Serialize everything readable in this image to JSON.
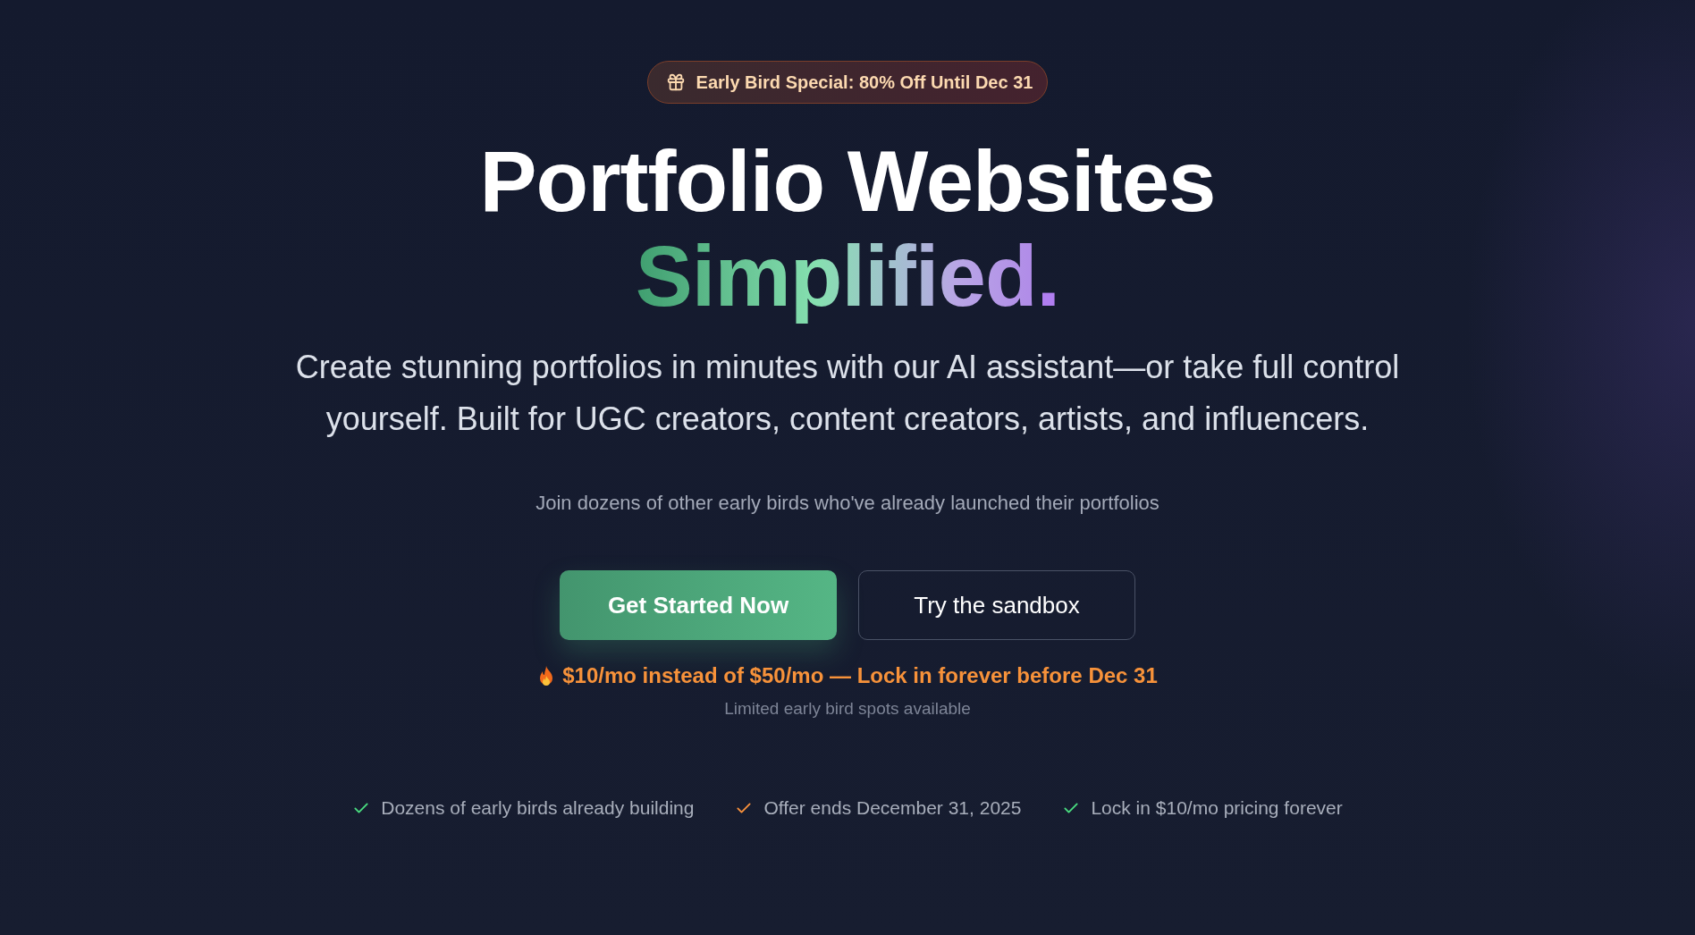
{
  "badge": {
    "text": "Early Bird Special: 80% Off Until Dec 31"
  },
  "heading": {
    "line_1": "Portfolio Websites",
    "line_2": "Simplified",
    "line_2_end": "."
  },
  "subtitle": "Create stunning portfolios in minutes with our AI assistant—or take full control yourself. Built for UGC creators, content creators, artists, and influencers.",
  "social_proof": "Join dozens of other early birds who've already launched their portfolios",
  "buttons": [
    {
      "label": "Get Started Now",
      "kind": "primary"
    },
    {
      "label": "Try the sandbox",
      "kind": "secondary"
    }
  ],
  "offer": {
    "text": "$10/mo instead of $50/mo — Lock in forever before Dec 31",
    "note": "Limited early bird spots available"
  },
  "features": [
    {
      "text": "Dozens of early birds already building",
      "color": "#4ade80"
    },
    {
      "text": "Offer ends December 31, 2025",
      "color": "#fb923c"
    },
    {
      "text": "Lock in $10/mo pricing forever",
      "color": "#4ade80"
    }
  ]
}
